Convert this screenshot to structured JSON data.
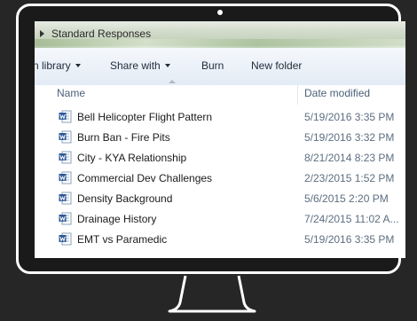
{
  "window": {
    "title": "Standard Responses"
  },
  "toolbar": {
    "include_library": "n library",
    "share_with": "Share with",
    "burn": "Burn",
    "new_folder": "New folder"
  },
  "columns": {
    "name": "Name",
    "date_modified": "Date modified"
  },
  "files": [
    {
      "name": "Bell Helicopter Flight Pattern",
      "date": "5/19/2016 3:35 PM",
      "icon": "word-doc-icon"
    },
    {
      "name": "Burn Ban - Fire Pits",
      "date": "5/19/2016 3:32 PM",
      "icon": "word-doc-icon"
    },
    {
      "name": "City - KYA Relationship",
      "date": "8/21/2014 8:23 PM",
      "icon": "word-doc-icon"
    },
    {
      "name": "Commercial Dev Challenges",
      "date": "2/23/2015 1:52 PM",
      "icon": "word-doc-icon"
    },
    {
      "name": "Density Background",
      "date": "5/6/2015 2:20 PM",
      "icon": "word-doc-icon"
    },
    {
      "name": "Drainage History",
      "date": "7/24/2015 11:02 A...",
      "icon": "word-doc-icon"
    },
    {
      "name": "EMT vs Paramedic",
      "date": "5/19/2016 3:35 PM",
      "icon": "word-doc-icon"
    }
  ],
  "colors": {
    "background": "#262626",
    "frame": "#ffffff",
    "word_blue": "#2b5797"
  }
}
